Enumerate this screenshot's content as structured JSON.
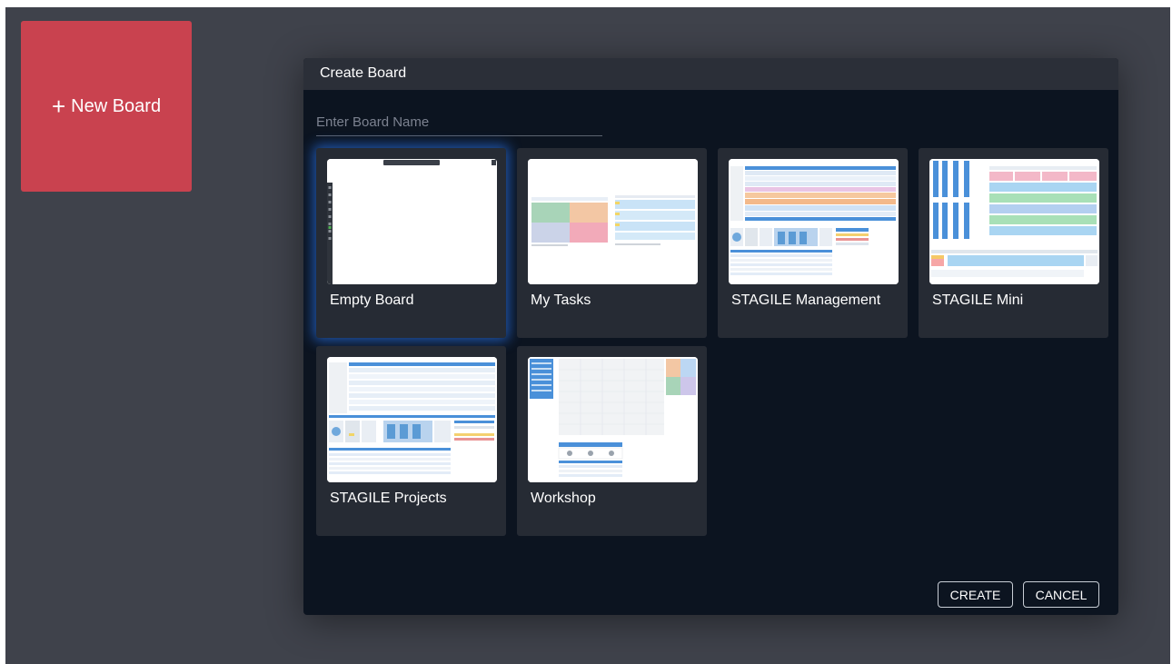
{
  "new_board": {
    "label": "New Board",
    "icon": "plus-icon"
  },
  "dialog": {
    "title": "Create Board",
    "name_input": {
      "placeholder": "Enter Board Name",
      "value": ""
    },
    "templates": [
      {
        "label": "Empty Board"
      },
      {
        "label": "My Tasks"
      },
      {
        "label": "STAGILE Management"
      },
      {
        "label": "STAGILE Mini"
      },
      {
        "label": "STAGILE Projects"
      },
      {
        "label": "Workshop"
      }
    ],
    "selected_template": "Empty Board",
    "create_label": "CREATE",
    "cancel_label": "CANCEL"
  },
  "colors": {
    "background": "#3f424b",
    "new_board": "#c9424f",
    "dialog": "#0c1420",
    "card": "#262b34",
    "selection_glow": "#286edc"
  }
}
